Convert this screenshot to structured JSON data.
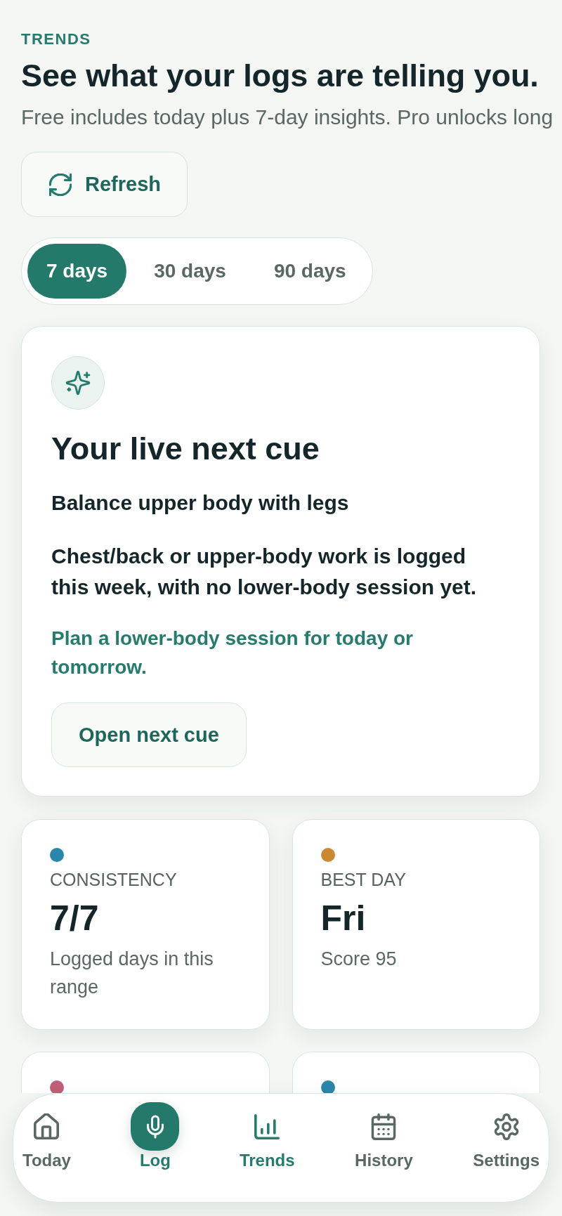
{
  "header": {
    "eyebrow": "TRENDS",
    "title": "See what your logs are telling you.",
    "subtitle": "Free includes today plus 7-day insights. Pro unlocks long"
  },
  "refresh_button": {
    "label": "Refresh"
  },
  "range_tabs": [
    {
      "label": "7 days",
      "selected": true
    },
    {
      "label": "30 days",
      "selected": false
    },
    {
      "label": "90 days",
      "selected": false
    }
  ],
  "cue_card": {
    "title": "Your live next cue",
    "headline": "Balance upper body with legs",
    "body": "Chest/back or upper-body work is logged this week, with no lower-body session yet.",
    "hint": "Plan a lower-body session for today or tomorrow.",
    "button": "Open next cue"
  },
  "stats": [
    {
      "color": "#2a86ab",
      "label": "CONSISTENCY",
      "value": "7/7",
      "note": "Logged days in this range"
    },
    {
      "color": "#cb8833",
      "label": "BEST DAY",
      "value": "Fri",
      "note": "Score 95"
    },
    {
      "color": "#c15f77"
    },
    {
      "color": "#2a86ab"
    }
  ],
  "bottom_nav": [
    {
      "label": "Today",
      "kind": "tab",
      "selected": false
    },
    {
      "label": "Log",
      "kind": "action",
      "selected": false
    },
    {
      "label": "Trends",
      "kind": "tab",
      "selected": true
    },
    {
      "label": "History",
      "kind": "tab",
      "selected": false
    },
    {
      "label": "Settings",
      "kind": "tab",
      "selected": false
    }
  ]
}
